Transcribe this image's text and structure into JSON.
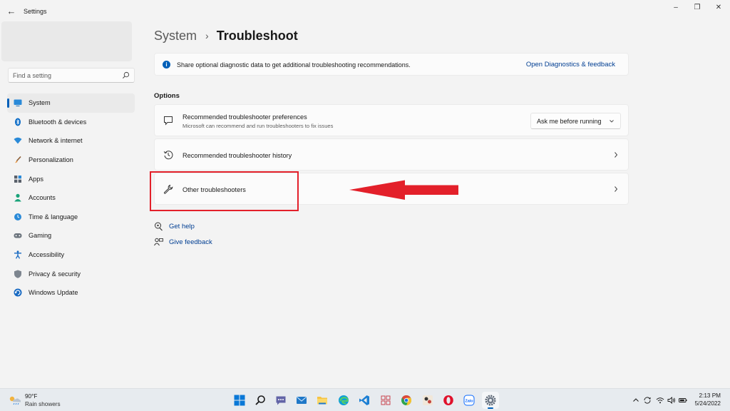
{
  "window": {
    "title": "Settings",
    "back_glyph": "←",
    "minimize_glyph": "–",
    "maximize_glyph": "❐",
    "close_glyph": "✕"
  },
  "sidebar": {
    "search_placeholder": "Find a setting",
    "items": [
      {
        "label": "System",
        "icon": "monitor-icon",
        "selected": true
      },
      {
        "label": "Bluetooth & devices",
        "icon": "bluetooth-icon"
      },
      {
        "label": "Network & internet",
        "icon": "wifi-icon"
      },
      {
        "label": "Personalization",
        "icon": "brush-icon"
      },
      {
        "label": "Apps",
        "icon": "apps-icon"
      },
      {
        "label": "Accounts",
        "icon": "person-icon"
      },
      {
        "label": "Time & language",
        "icon": "globe-clock-icon"
      },
      {
        "label": "Gaming",
        "icon": "gamepad-icon"
      },
      {
        "label": "Accessibility",
        "icon": "accessibility-icon"
      },
      {
        "label": "Privacy & security",
        "icon": "shield-icon"
      },
      {
        "label": "Windows Update",
        "icon": "update-icon"
      }
    ]
  },
  "main": {
    "breadcrumb": {
      "parent": "System",
      "separator": "›",
      "current": "Troubleshoot"
    },
    "info": {
      "text": "Share optional diagnostic data to get additional troubleshooting recommendations.",
      "link": "Open Diagnostics & feedback",
      "icon_glyph": "i"
    },
    "section_label": "Options",
    "rows": [
      {
        "title": "Recommended troubleshooter preferences",
        "subtitle": "Microsoft can recommend and run troubleshooters to fix issues",
        "dropdown_value": "Ask me before running"
      },
      {
        "title": "Recommended troubleshooter history"
      },
      {
        "title": "Other troubleshooters"
      }
    ],
    "links": {
      "help": "Get help",
      "feedback": "Give feedback"
    }
  },
  "taskbar": {
    "weather": {
      "temp": "90°F",
      "desc": "Rain showers"
    },
    "apps": [
      {
        "name": "start-button"
      },
      {
        "name": "search-button"
      },
      {
        "name": "chat-button"
      },
      {
        "name": "mail-app"
      },
      {
        "name": "file-explorer-app"
      },
      {
        "name": "edge-app"
      },
      {
        "name": "vscode-app"
      },
      {
        "name": "tools-app"
      },
      {
        "name": "chrome-app"
      },
      {
        "name": "photo-app"
      },
      {
        "name": "opera-app"
      },
      {
        "name": "zalo-app"
      },
      {
        "name": "settings-app",
        "active": true
      }
    ],
    "zalo_label": "Zalo",
    "clock": {
      "time": "2:13 PM",
      "date": "5/24/2022"
    }
  },
  "colors": {
    "accent": "#005fb8",
    "link": "#003e92",
    "highlight": "#e3202a"
  }
}
